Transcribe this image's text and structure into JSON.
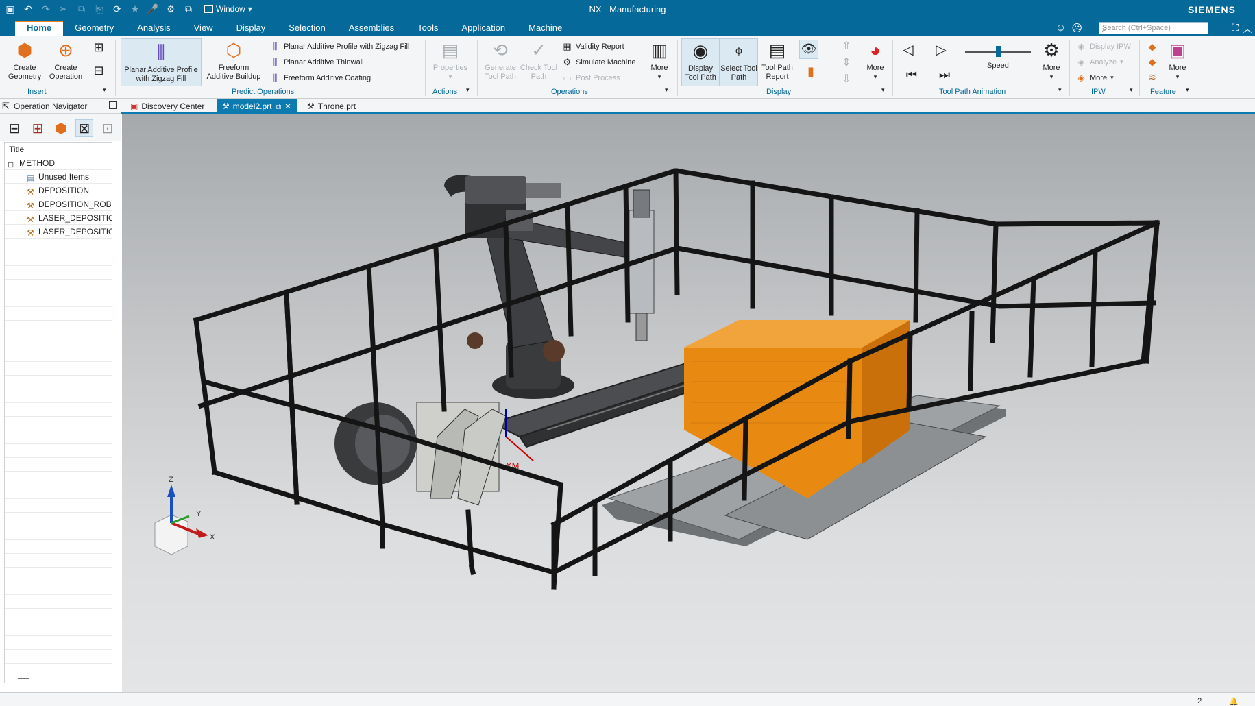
{
  "title_bar": {
    "window_label": "Window",
    "title": "NX - Manufacturing",
    "brand": "SIEMENS",
    "search_placeholder": "Search (Ctrl+Space)"
  },
  "menu_tabs": [
    "Home",
    "Geometry",
    "Analysis",
    "View",
    "Display",
    "Selection",
    "Assemblies",
    "Tools",
    "Application",
    "Machine"
  ],
  "active_tab": "Home",
  "ribbon": {
    "insert": {
      "create_geometry": "Create Geometry",
      "create_operation": "Create Operation",
      "group": "Insert"
    },
    "predict": {
      "planar_zigzag": "Planar Additive Profile with Zigzag Fill",
      "freeform_buildup": "Freeform Additive Buildup",
      "small_1": "Planar Additive Profile with Zigzag Fill",
      "small_2": "Planar Additive Thinwall",
      "small_3": "Freeform Additive Coating",
      "group": "Predict Operations"
    },
    "actions": {
      "properties": "Properties",
      "group": "Actions"
    },
    "operations": {
      "generate": "Generate Tool Path",
      "check": "Check Tool Path",
      "validity": "Validity Report",
      "simulate": "Simulate Machine",
      "post": "Post Process",
      "more": "More",
      "group": "Operations"
    },
    "display": {
      "display_tp": "Display Tool Path",
      "select_tp": "Select Tool Path",
      "tp_report": "Tool Path Report",
      "group": "Display"
    },
    "animation": {
      "more": "More",
      "speed": "Speed",
      "more2": "More",
      "group": "Tool Path Animation",
      "speed_level": 0.5
    },
    "ipw": {
      "display_ipw": "Display IPW",
      "analyze": "Analyze",
      "more": "More",
      "group": "IPW"
    },
    "feature": {
      "more": "More",
      "group": "Feature"
    }
  },
  "navigator": {
    "title": "Operation Navigator",
    "column": "Title",
    "tree": [
      {
        "label": "METHOD",
        "level": 0,
        "icon": "minus-box-icon"
      },
      {
        "label": "Unused Items",
        "level": 1,
        "icon": "folder-icon"
      },
      {
        "label": "DEPOSITION",
        "level": 1,
        "icon": "method-icon"
      },
      {
        "label": "DEPOSITION_ROBC",
        "level": 1,
        "icon": "method-icon"
      },
      {
        "label": "LASER_DEPOSITION",
        "level": 1,
        "icon": "method-icon"
      },
      {
        "label": "LASER_DEPOSITION",
        "level": 1,
        "icon": "method-icon"
      }
    ]
  },
  "doc_tabs": [
    "Discovery Center",
    "model2.prt",
    "Throne.prt"
  ],
  "active_doc_tab": "model2.prt",
  "viewport": {
    "triad": {
      "x": "X",
      "y": "Y",
      "z": "Z"
    },
    "wcs_label": "XM"
  },
  "status_bar": {
    "notifications": "2 Notifications"
  },
  "colors": {
    "title_bar": "#05699a",
    "accent": "#e8841c",
    "part_orange": "#e88a12",
    "frame": "#1a1a1a"
  }
}
